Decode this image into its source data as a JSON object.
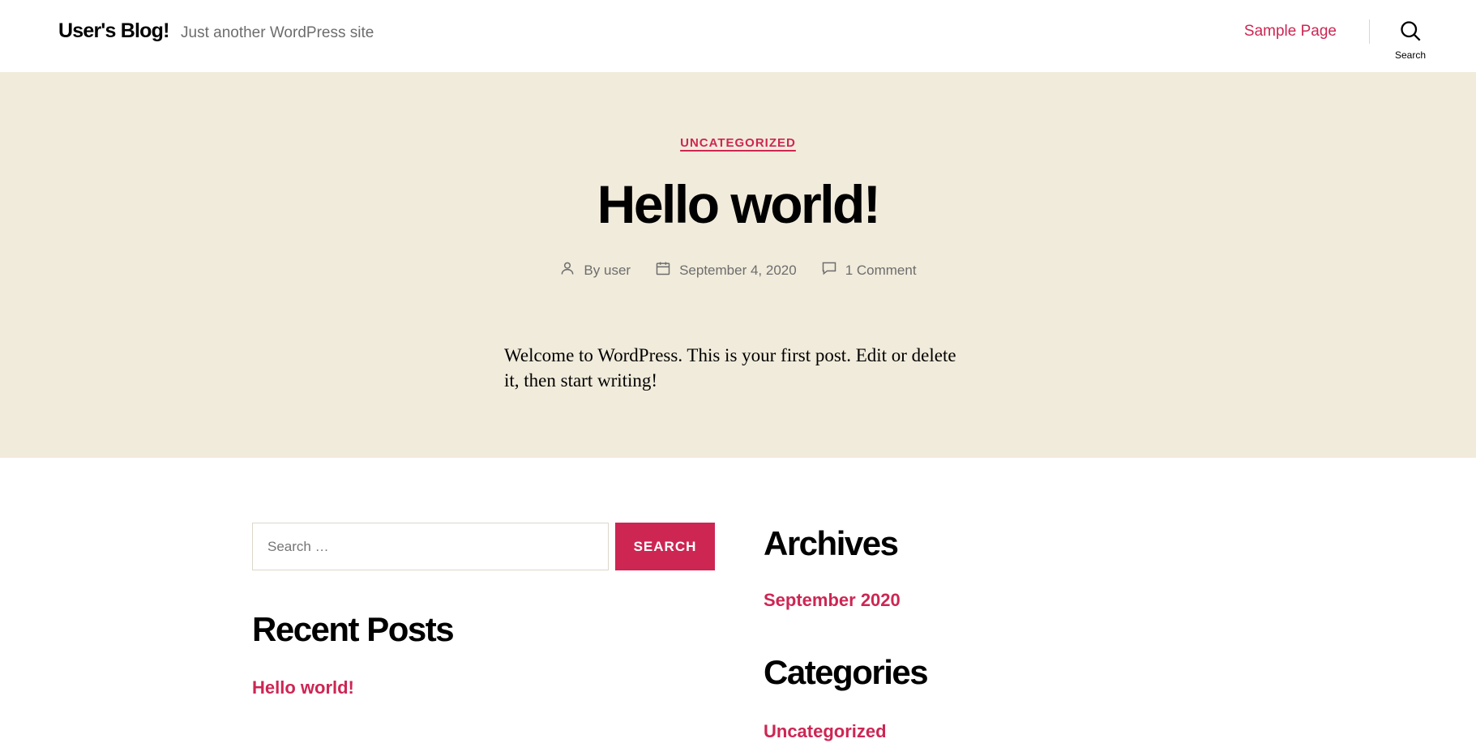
{
  "header": {
    "site_title": "User's Blog!",
    "site_description": "Just another WordPress site",
    "nav_link": "Sample Page",
    "search_toggle_label": "Search"
  },
  "post": {
    "category": "UNCATEGORIZED",
    "title": "Hello world!",
    "author_prefix": "By",
    "author": "user",
    "date": "September 4, 2020",
    "comments": "1 Comment",
    "content": "Welcome to WordPress. This is your first post. Edit or delete it, then start writing!"
  },
  "widgets": {
    "search": {
      "placeholder": "Search …",
      "button_label": "SEARCH"
    },
    "recent_posts": {
      "title": "Recent Posts",
      "items": [
        "Hello world!"
      ]
    },
    "archives": {
      "title": "Archives",
      "items": [
        "September 2020"
      ]
    },
    "categories": {
      "title": "Categories",
      "items": [
        "Uncategorized"
      ]
    }
  },
  "colors": {
    "accent": "#cd2653",
    "hero_background": "#f1ebdb",
    "secondary_text": "#6d6d6d"
  },
  "icons": {
    "search_toggle": "search-icon",
    "author": "person-icon",
    "date": "calendar-icon",
    "comments": "comment-icon"
  }
}
